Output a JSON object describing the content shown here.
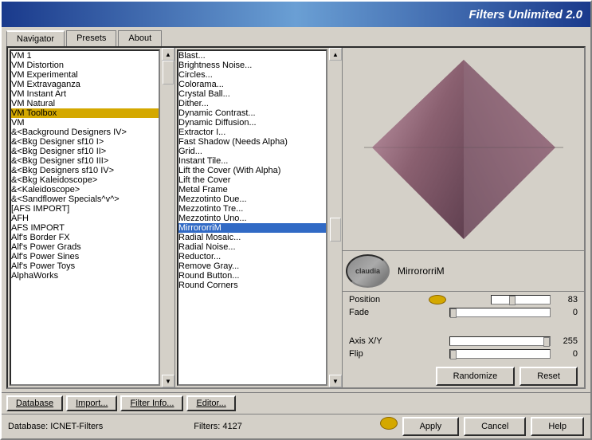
{
  "app": {
    "title": "Filters Unlimited 2.0"
  },
  "tabs": [
    {
      "label": "Navigator",
      "active": true
    },
    {
      "label": "Presets",
      "active": false
    },
    {
      "label": "About",
      "active": false
    }
  ],
  "left_list": {
    "items": [
      "VM 1",
      "VM Distortion",
      "VM Experimental",
      "VM Extravaganza",
      "VM Instant Art",
      "VM Natural",
      "VM Toolbox",
      "VM",
      "&<Background Designers IV>",
      "&<Bkg Designer sf10 I>",
      "&<Bkg Designer sf10 II>",
      "&<Bkg Designer sf10 III>",
      "&<Bkg Designers sf10 IV>",
      "&<Bkg Kaleidoscope>",
      "&<Kaleidoscope>",
      "&<Sandflower Specials^v^>",
      "[AFS IMPORT]",
      "AFH",
      "AFS IMPORT",
      "Alf's Border FX",
      "Alf's Power Grads",
      "Alf's Power Sines",
      "Alf's Power Toys",
      "AlphaWorks"
    ],
    "selected": "VM Toolbox"
  },
  "middle_list": {
    "items": [
      "Blast...",
      "Brightness Noise...",
      "Circles...",
      "Colorama...",
      "Crystal Ball...",
      "Dither...",
      "Dynamic Contrast...",
      "Dynamic Diffusion...",
      "Extractor I...",
      "Fast Shadow (Needs Alpha)",
      "Grid...",
      "Instant Tile...",
      "Lift the Cover (With Alpha)",
      "Lift the Cover",
      "Metal Frame",
      "Mezzotinto Due...",
      "Mezzotinto Tre...",
      "Mezzotinto Uno...",
      "MirrororriM",
      "Radial Mosaic...",
      "Radial Noise...",
      "Reductor...",
      "Remove Gray...",
      "Round Button...",
      "Round Corners"
    ],
    "selected": "MirrororriM"
  },
  "filter_name": "MirrororriM",
  "thumbnail_label": "claudia",
  "params": [
    {
      "label": "Position",
      "value": 83,
      "max": 255,
      "pct": 32
    },
    {
      "label": "Fade",
      "value": 0,
      "max": 255,
      "pct": 0
    },
    {
      "label": "",
      "value": null
    },
    {
      "label": "",
      "value": null
    },
    {
      "label": "Axis X/Y",
      "value": 255,
      "max": 255,
      "pct": 100
    },
    {
      "label": "Flip",
      "value": 0,
      "max": 255,
      "pct": 0
    }
  ],
  "toolbar": {
    "database": "Database",
    "import": "Import...",
    "filter_info": "Filter Info...",
    "editor": "Editor...",
    "randomize": "Randomize",
    "reset": "Reset"
  },
  "status": {
    "db_label": "Database:",
    "db_value": "ICNET-Filters",
    "filters_label": "Filters:",
    "filters_value": "4127"
  },
  "actions": {
    "apply": "Apply",
    "cancel": "Cancel",
    "help": "Help"
  }
}
